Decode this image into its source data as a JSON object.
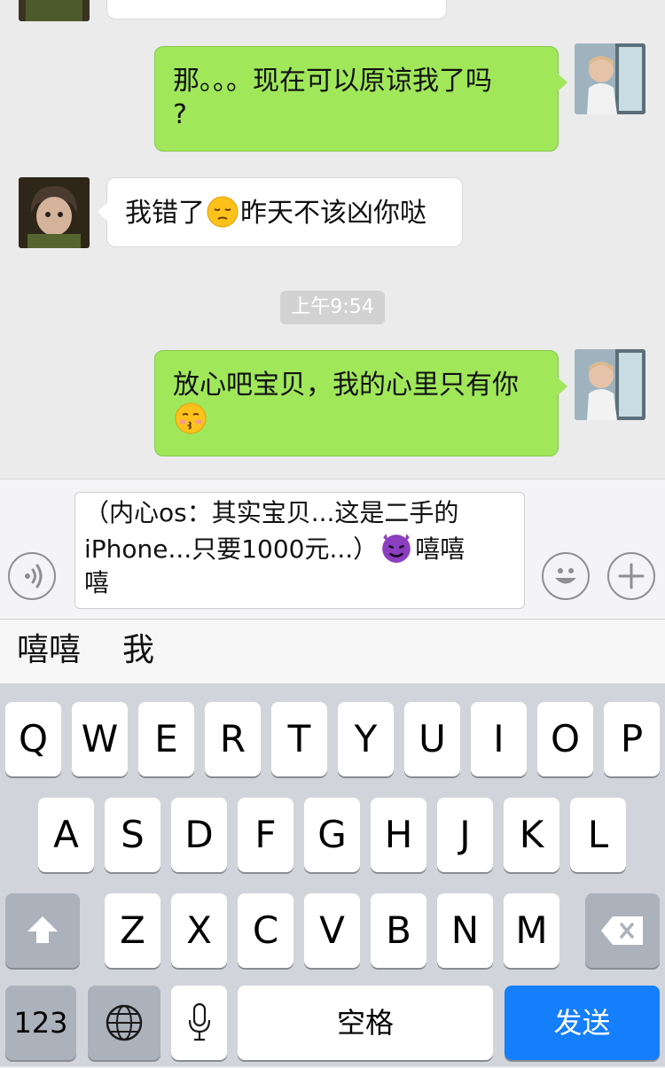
{
  "chat": {
    "messages": [
      {
        "id": "m1",
        "side": "out",
        "text_line1": "那。。。现在可以原谅我了吗",
        "text_line2": "?"
      },
      {
        "id": "m2",
        "side": "in",
        "text_before": "我错了",
        "emoji": "pensive-face",
        "text_after": "昨天不该凶你哒"
      },
      {
        "id": "m3",
        "side": "out",
        "text_line1": "放心吧宝贝，我的心里只有你",
        "emoji": "kissing-face"
      }
    ],
    "timestamp": "上午9:54"
  },
  "input": {
    "text_line1": "（内心os：其实宝贝...这是二手的",
    "text_line2_before": "iPhone...只要1000元...）",
    "emoji": "smiling-devil-face",
    "text_line2_after": "嘻嘻",
    "text_line3": "嘻",
    "voice_icon": "voice-icon",
    "emoji_button_icon": "smiley-icon",
    "plus_icon": "plus-icon"
  },
  "candidates": [
    "嘻嘻",
    "我"
  ],
  "keyboard": {
    "row1": [
      "Q",
      "W",
      "E",
      "R",
      "T",
      "Y",
      "U",
      "I",
      "O",
      "P"
    ],
    "row2": [
      "A",
      "S",
      "D",
      "F",
      "G",
      "H",
      "J",
      "K",
      "L"
    ],
    "row3": [
      "Z",
      "X",
      "C",
      "V",
      "B",
      "N",
      "M"
    ],
    "numbers_label": "123",
    "space_label": "空格",
    "send_label": "发送",
    "colors": {
      "send": "#147efb",
      "bubble_out": "#a0e75a",
      "bubble_in": "#ffffff"
    }
  }
}
